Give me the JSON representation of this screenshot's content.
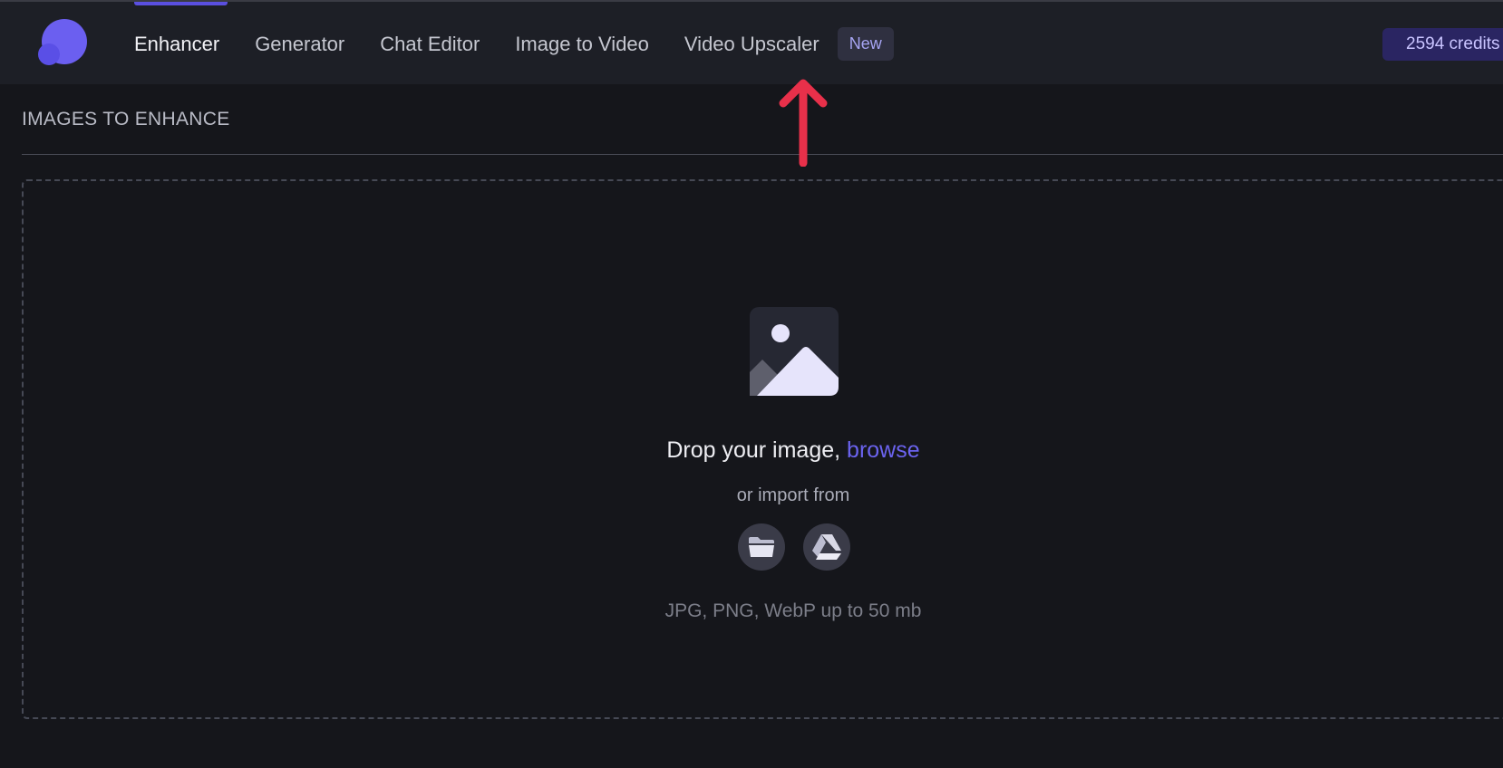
{
  "nav": {
    "items": [
      {
        "label": "Enhancer",
        "active": true
      },
      {
        "label": "Generator",
        "active": false
      },
      {
        "label": "Chat Editor",
        "active": false
      },
      {
        "label": "Image to Video",
        "active": false
      },
      {
        "label": "Video Upscaler",
        "active": false
      }
    ],
    "new_badge": "New"
  },
  "credits": {
    "label": "2594 credits"
  },
  "section": {
    "title": "IMAGES TO ENHANCE"
  },
  "dropzone": {
    "prompt": "Drop your image, ",
    "browse_link": "browse",
    "import_label": "or import from",
    "import_sources": [
      "folder-icon",
      "google-drive-icon"
    ],
    "formats_hint": "JPG, PNG, WebP up to 50 mb"
  },
  "colors": {
    "accent": "#6b63ef",
    "annotation_arrow": "#e8304a",
    "background": "#15161b",
    "topbar": "#1d1f26"
  }
}
